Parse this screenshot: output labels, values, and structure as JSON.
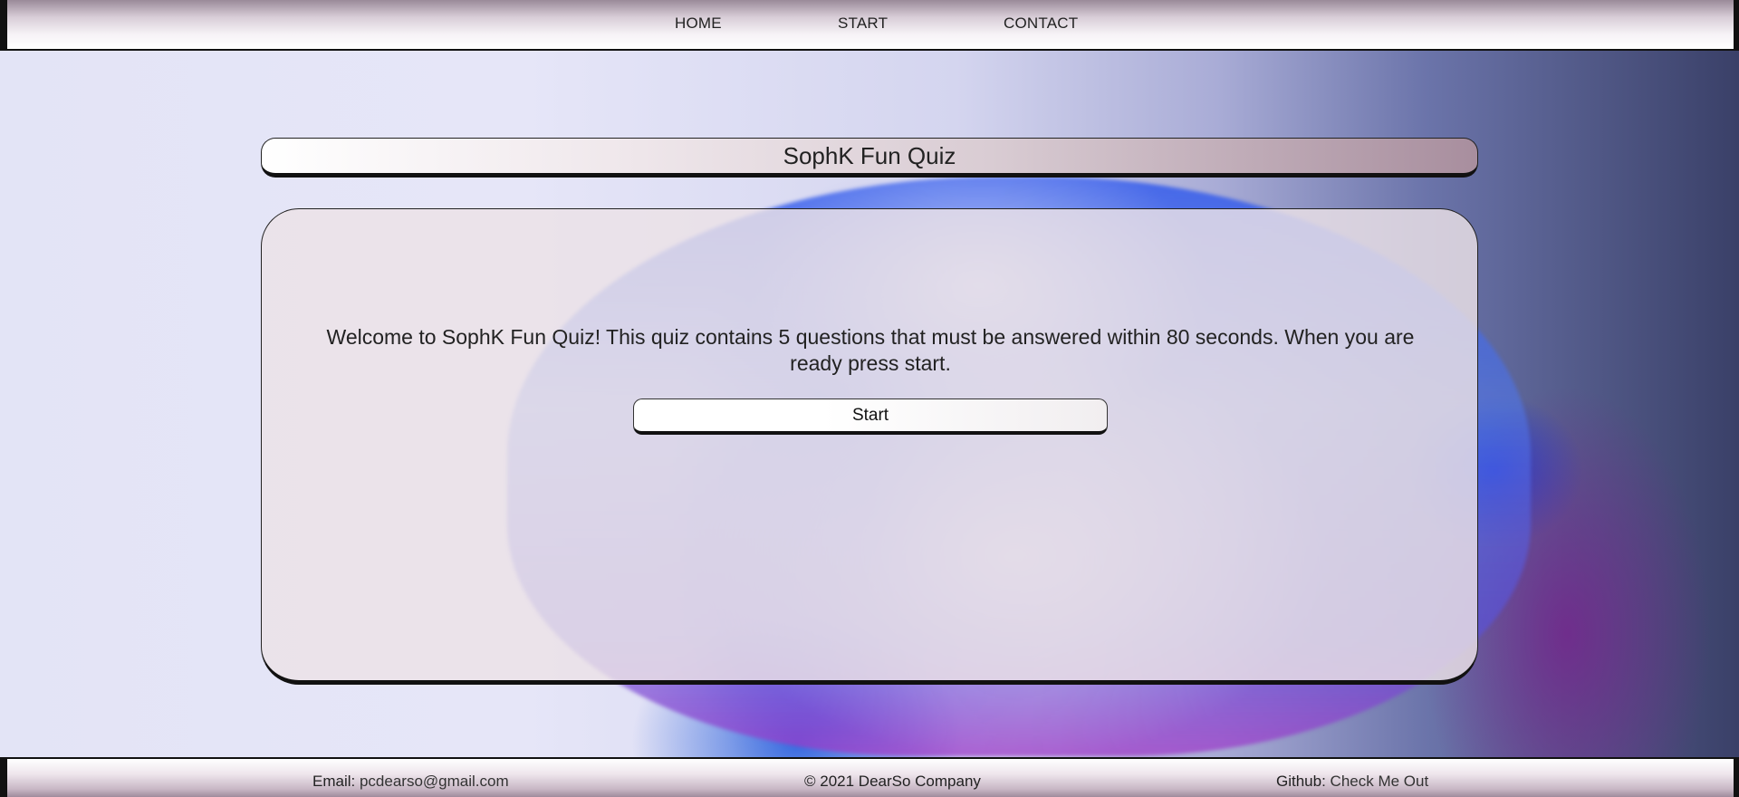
{
  "nav": {
    "home": "HOME",
    "start": "START",
    "contact": "CONTACT"
  },
  "quiz": {
    "title": "SophK Fun Quiz",
    "welcome": "Welcome to SophK Fun Quiz! This quiz contains 5 questions that must be answered within 80 seconds. When you are ready press start.",
    "start_label": "Start"
  },
  "footer": {
    "email_label": "Email: ",
    "email_value": "pcdearso@gmail.com",
    "copyright": "© 2021 DearSo Company",
    "github_label": "Github: ",
    "github_link": "Check Me Out"
  },
  "icons": {
    "background": "blue-rose-image"
  },
  "colors": {
    "header_top": "#9a8a99",
    "title_end": "#a88e9e",
    "card_bg": "#ece2e7"
  }
}
